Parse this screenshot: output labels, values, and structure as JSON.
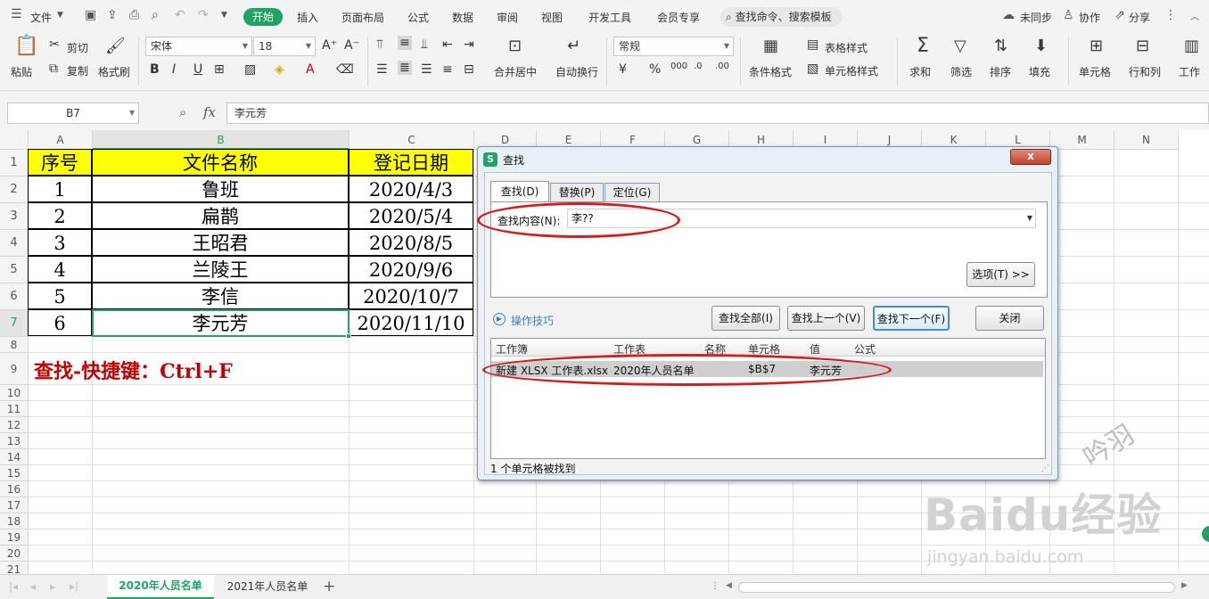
{
  "menubar": {
    "file_label": "文件",
    "tabs": [
      "开始",
      "插入",
      "页面布局",
      "公式",
      "数据",
      "审阅",
      "视图",
      "开发工具",
      "会员专享"
    ],
    "search_placeholder": "查找命令、搜索模板",
    "sync_label": "未同步",
    "collab_label": "协作",
    "share_label": "分享"
  },
  "ribbon": {
    "paste": "粘贴",
    "cut": "剪切",
    "copy": "复制",
    "format_painter": "格式刷",
    "font_name": "宋体",
    "font_size": "18",
    "merge_center": "合并居中",
    "wrap_text": "自动换行",
    "number_format": "常规",
    "cond_format": "条件格式",
    "table_style": "表格样式",
    "cell_style": "单元格样式",
    "sum": "求和",
    "filter": "筛选",
    "sort": "排序",
    "fill": "填充",
    "cell": "单元格",
    "row_col": "行和列",
    "worksheet": "工作"
  },
  "formula_bar": {
    "name_box": "B7",
    "fx": "fx",
    "content": "李元芳"
  },
  "sheet": {
    "columns": [
      "A",
      "B",
      "C",
      "D",
      "E",
      "F",
      "G",
      "H",
      "I",
      "J",
      "K",
      "L",
      "M",
      "N"
    ],
    "rows": [
      "1",
      "2",
      "3",
      "4",
      "5",
      "6",
      "7",
      "8",
      "9",
      "10",
      "11",
      "12",
      "13",
      "14",
      "15",
      "16",
      "17",
      "18",
      "19",
      "20",
      "21"
    ],
    "header": [
      "序号",
      "文件名称",
      "登记日期"
    ],
    "data": [
      [
        "1",
        "鲁班",
        "2020/4/3"
      ],
      [
        "2",
        "扁鹊",
        "2020/5/4"
      ],
      [
        "3",
        "王昭君",
        "2020/8/5"
      ],
      [
        "4",
        "兰陵王",
        "2020/9/6"
      ],
      [
        "5",
        "李信",
        "2020/10/7"
      ],
      [
        "6",
        "李元芳",
        "2020/11/10"
      ]
    ],
    "note": "查找-快捷键：Ctrl+F",
    "header_fill": "#ffff00",
    "note_color": "#c00000"
  },
  "sheet_tabs": {
    "tabs": [
      "2020年人员名单",
      "2021年人员名单"
    ],
    "active_color": "#21a366"
  },
  "dialog": {
    "title": "查找",
    "close": "x",
    "tabs": [
      "查找(D)",
      "替换(P)",
      "定位(G)"
    ],
    "find_label": "查找内容(N):",
    "find_value": "李??",
    "options_button": "选项(T) >>",
    "tips_link": "操作技巧",
    "buttons": [
      "查找全部(I)",
      "查找上一个(V)",
      "查找下一个(F)",
      "关闭"
    ],
    "result_headers": [
      "工作簿",
      "工作表",
      "名称",
      "单元格",
      "值",
      "公式"
    ],
    "result_row": [
      "新建 XLSX 工作表.xlsx",
      "2020年人员名单",
      "",
      "$B$7",
      "李元芳",
      ""
    ],
    "status": "1 个单元格被找到",
    "highlight_color": "#d21f1f"
  },
  "watermark": {
    "signature": "吟羽",
    "brand": "Baidu经验",
    "url": "jingyan.baidu.com"
  }
}
